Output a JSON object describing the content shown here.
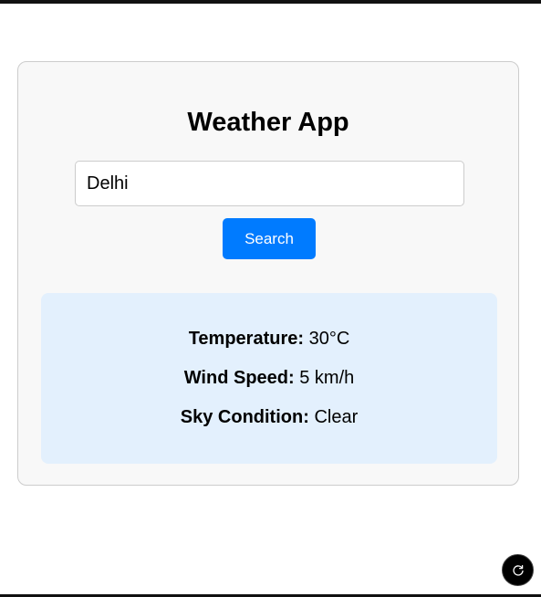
{
  "app": {
    "title": "Weather App"
  },
  "search": {
    "value": "Delhi",
    "button_label": "Search"
  },
  "weather": {
    "temperature_label": "Temperature:",
    "temperature_value": "30°C",
    "wind_label": "Wind Speed:",
    "wind_value": "5 km/h",
    "sky_label": "Sky Condition:",
    "sky_value": "Clear"
  },
  "controls": {
    "refresh_icon": "refresh-icon"
  },
  "colors": {
    "accent": "#007bff",
    "result_background": "#e3f0fd",
    "card_background": "#f8f8f8"
  }
}
